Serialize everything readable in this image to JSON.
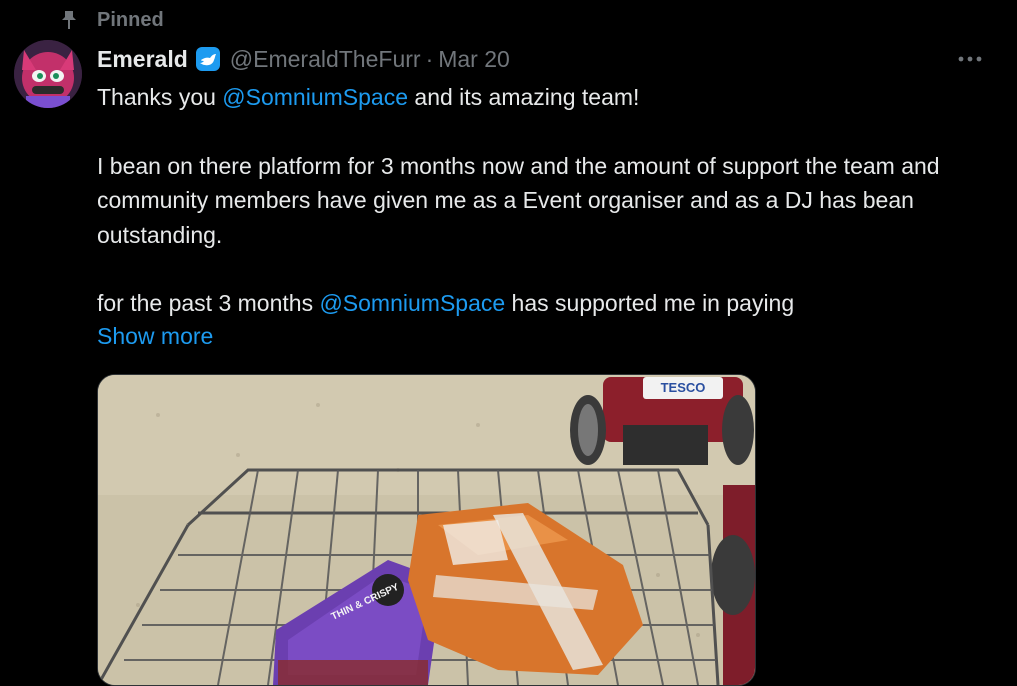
{
  "pinned": {
    "label": "Pinned",
    "icon": "pin-icon"
  },
  "author": {
    "display_name": "Emerald",
    "handle": "@EmeraldTheFurr",
    "separator": "·",
    "date": "Mar 20",
    "verified_icon": "verified-badge-icon",
    "avatar": "avatar"
  },
  "tweet": {
    "line1_before": "Thanks you ",
    "line1_mention": "@SomniumSpace",
    "line1_after": " and its amazing team!",
    "para2": "I bean on there platform for 3 months now and the amount of support the team and community members have given me as a Event organiser and as a DJ has bean outstanding.",
    "para3_before": "for the past 3 months ",
    "para3_mention": "@SomniumSpace",
    "para3_after": " has supported me in paying",
    "show_more": "Show more"
  },
  "media": {
    "sign_text": "TESCO",
    "pizza_text": "THIN & CRISPY"
  },
  "colors": {
    "background": "#000000",
    "text": "#e7e9ea",
    "secondary": "#71767b",
    "link": "#1d9bf0",
    "verified": "#1d9bf0"
  },
  "more_icon": "more-options-icon"
}
